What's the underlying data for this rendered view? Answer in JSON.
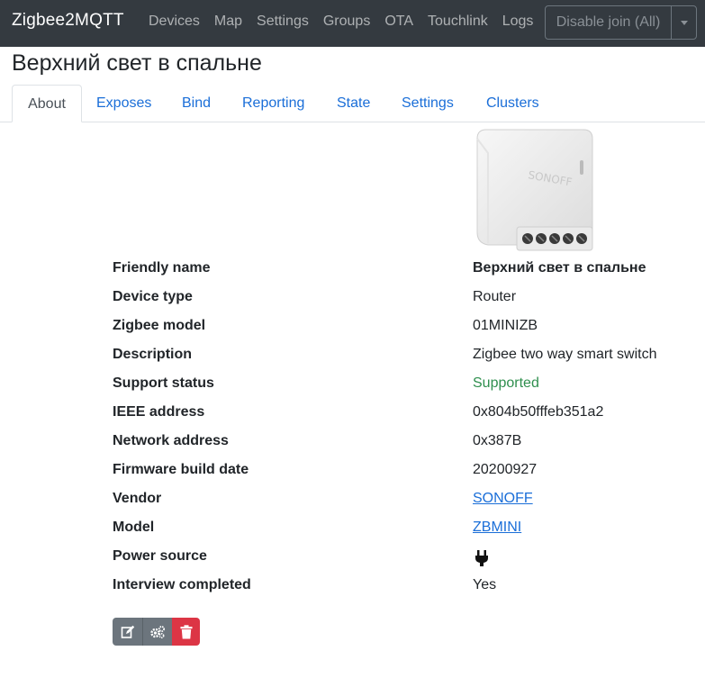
{
  "navbar": {
    "brand": "Zigbee2MQTT",
    "links": [
      "Devices",
      "Map",
      "Settings",
      "Groups",
      "OTA",
      "Touchlink",
      "Logs"
    ],
    "join_button": "Disable join (All)"
  },
  "page": {
    "title": "Верхний свет в спальне"
  },
  "tabs": [
    "About",
    "Exposes",
    "Bind",
    "Reporting",
    "State",
    "Settings",
    "Clusters"
  ],
  "active_tab": "About",
  "details": [
    {
      "label": "Friendly name",
      "value": "Верхний свет в спальне"
    },
    {
      "label": "Device type",
      "value": "Router"
    },
    {
      "label": "Zigbee model",
      "value": "01MINIZB"
    },
    {
      "label": "Description",
      "value": "Zigbee two way smart switch"
    },
    {
      "label": "Support status",
      "value": "Supported"
    },
    {
      "label": "IEEE address",
      "value": "0x804b50fffeb351a2"
    },
    {
      "label": "Network address",
      "value": "0x387B"
    },
    {
      "label": "Firmware build date",
      "value": "20200927"
    },
    {
      "label": "Vendor",
      "value": "SONOFF"
    },
    {
      "label": "Model",
      "value": "ZBMINI"
    },
    {
      "label": "Power source",
      "value_icon": "plug-icon"
    },
    {
      "label": "Interview completed",
      "value": "Yes"
    }
  ],
  "colors": {
    "navbar_bg": "#343a40",
    "link": "#1a6ed8",
    "supported": "#2f8f4e",
    "danger": "#dc3545",
    "secondary": "#6c757d"
  },
  "icons": {
    "rename": "edit-icon",
    "configure": "cogs-icon",
    "remove": "trash-icon",
    "join_dropdown": "caret-down-icon"
  }
}
